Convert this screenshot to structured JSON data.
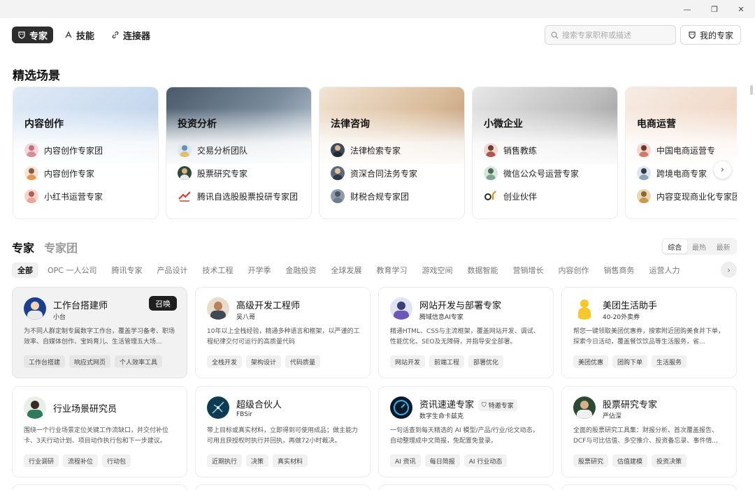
{
  "window": {
    "minimize": "—",
    "maximize": "❐",
    "close": "✕"
  },
  "nav": {
    "tabs": [
      {
        "label": "专家",
        "icon": "expert-icon",
        "active": true
      },
      {
        "label": "技能",
        "icon": "skill-icon",
        "active": false
      },
      {
        "label": "连接器",
        "icon": "link-icon",
        "active": false
      }
    ],
    "search_placeholder": "搜索专家职称或描述",
    "my_experts": "我的专家"
  },
  "featured": {
    "title": "精选场景",
    "cards": [
      {
        "title": "内容创作",
        "items": [
          "内容创作专家团",
          "内容创作专家",
          "小红书运营专家"
        ]
      },
      {
        "title": "投资分析",
        "items": [
          "交易分析团队",
          "股票研究专家",
          "腾讯自选股股票投研专家团"
        ]
      },
      {
        "title": "法律咨询",
        "items": [
          "法律检索专家",
          "资深合同法务专家",
          "财税合规专家团"
        ]
      },
      {
        "title": "小微企业",
        "items": [
          "销售教练",
          "微信公众号运营专家",
          "创业伙伴"
        ]
      },
      {
        "title": "电商运营",
        "items": [
          "中国电商运营专",
          "跨境电商专家",
          "内容变现商业化专家团"
        ]
      }
    ]
  },
  "experts": {
    "tab_experts": "专家",
    "tab_teams": "专家团",
    "sorts": [
      "综合",
      "最热",
      "最新"
    ],
    "categories": [
      "全部",
      "OPC 一人公司",
      "腾讯专家",
      "产品设计",
      "技术工程",
      "开学季",
      "金融投资",
      "全球发展",
      "教育学习",
      "游戏空间",
      "数据智能",
      "营销增长",
      "内容创作",
      "销售商务",
      "运营人力"
    ],
    "summon_label": "召唤",
    "cards": [
      {
        "name": "工作台搭建师",
        "sub": "小台",
        "desc": "为不同人群定制专属数字工作台，覆盖学习备考、职场效率、自媒体创作、宝妈育儿、生活管理五大场...",
        "tags": [
          "工作台搭建",
          "响应式网页",
          "个人效率工具"
        ]
      },
      {
        "name": "高级开发工程师",
        "sub": "吴八哥",
        "desc": "10年以上全栈经验，精通多种语言和框架，以严谨的工程纪律交付可运行的高质量代码",
        "tags": [
          "全栈开发",
          "架构设计",
          "代码质量"
        ]
      },
      {
        "name": "网站开发与部署专家",
        "sub": "腾域信息AI专家",
        "desc": "精通HTML、CSS与主流框架，覆盖网站开发、调试、性能优化、SEO及无障碍，并指导安全部署。",
        "tags": [
          "网站开发",
          "前端工程",
          "部署优化"
        ]
      },
      {
        "name": "美团生活助手",
        "sub": "40-20外卖券",
        "desc": "帮您一键领取美团优惠券，搜索附近团购美食并下单，探索今日活动，覆盖餐饮饮品等生活服务，省...",
        "tags": [
          "美团优惠",
          "团购下单",
          "生活服务"
        ]
      },
      {
        "name": "行业场景研究员",
        "sub": "",
        "desc": "围绕一个行业场景定位关键工作流缺口，并交付补位卡、3天行动计划、项目动作执行包和下一步建议。",
        "tags": [
          "行业调研",
          "流程补位",
          "行动包"
        ]
      },
      {
        "name": "超级合伙人",
        "sub": "FBSir",
        "desc": "带上目标或真实材料，立即得到可使用成品；做主能力可用且获授权时执行并回执，再做72小时裁决。",
        "tags": [
          "近期执行",
          "决策",
          "真实材料"
        ]
      },
      {
        "name": "资讯速递专家",
        "sub": "数字生命卡兹克",
        "badge": "特邀专家",
        "desc": "一句话查到每天精选的 AI 模型/产品/行业/论文动态，自动整理成中文简报，免配置免登录。",
        "tags": [
          "AI 资讯",
          "每日简报",
          "AI 行业动态"
        ]
      },
      {
        "name": "股票研究专家",
        "sub": "严佔深",
        "desc": "全面的股票研究工具集：财报分析、首次覆盖报告、DCF与可比估值、多空推介、投资备忘录、事件情...",
        "tags": [
          "股票研究",
          "估值建模",
          "投资决策"
        ]
      }
    ]
  },
  "colors": {
    "accent": "#1f1f1f",
    "tag_bg": "#f1f1f1"
  }
}
